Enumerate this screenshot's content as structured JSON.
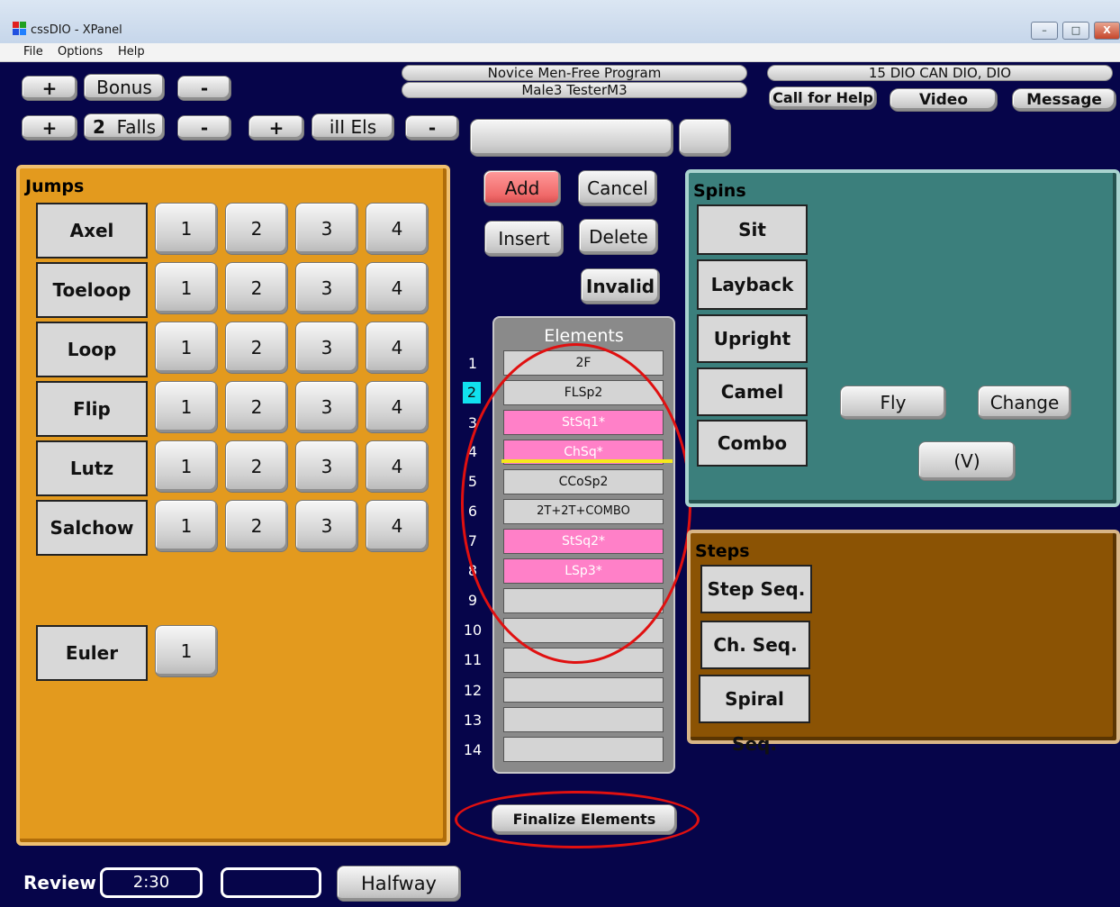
{
  "window": {
    "title": "cssDIO - XPanel"
  },
  "menu": [
    "File",
    "Options",
    "Help"
  ],
  "top": {
    "plus": "+",
    "minus": "-",
    "bonus_label": "Bonus",
    "falls_count": "2",
    "falls_label": "Falls",
    "illels_label": "iII Els",
    "program": "Novice Men-Free Program",
    "skater": "Male3 TesterM3",
    "competition": "15 DIO CAN DIO, DIO",
    "call_help": "Call for Help",
    "video": "Video",
    "message": "Message"
  },
  "actions": {
    "add": "Add",
    "cancel": "Cancel",
    "insert": "Insert",
    "delete": "Delete",
    "invalid": "Invalid"
  },
  "jumps": {
    "title": "Jumps",
    "rows": [
      "Axel",
      "Toeloop",
      "Loop",
      "Flip",
      "Lutz",
      "Salchow"
    ],
    "levels": [
      "1",
      "2",
      "3",
      "4"
    ],
    "euler": "Euler",
    "euler_level": "1"
  },
  "elements": {
    "title": "Elements",
    "numbers": [
      "1",
      "2",
      "3",
      "4",
      "5",
      "6",
      "7",
      "8",
      "9",
      "10",
      "11",
      "12",
      "13",
      "14"
    ],
    "items": [
      "2F",
      "FLSp2",
      "StSq1*",
      "ChSq*",
      "CCoSp2",
      "2T+2T+COMBO",
      "StSq2*",
      "LSp3*",
      "",
      "",
      "",
      "",
      "",
      ""
    ],
    "selected_number": "2",
    "finalize": "Finalize Elements"
  },
  "spins": {
    "title": "Spins",
    "items": [
      "Sit",
      "Layback",
      "Upright",
      "Camel",
      "Combo"
    ],
    "fly": "Fly",
    "change": "Change",
    "v": "(V)"
  },
  "steps": {
    "title": "Steps",
    "items": [
      "Step Seq.",
      "Ch. Seq.",
      "Spiral Seq."
    ]
  },
  "bottom": {
    "review": "Review",
    "time": "2:30",
    "halfway": "Halfway"
  },
  "colors": {
    "background": "#06054a",
    "jumps_panel": "#e39a1e",
    "spins_panel": "#3b7f7c",
    "steps_panel": "#8b5304",
    "pink": "#ff80c8",
    "add": "#f06a6a"
  }
}
